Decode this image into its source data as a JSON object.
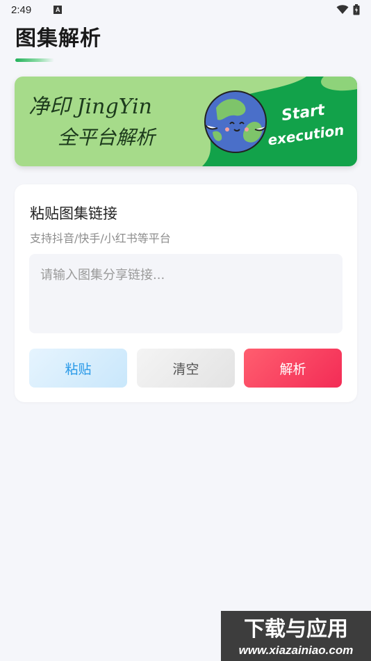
{
  "status_bar": {
    "time": "2:49",
    "notification_icon": "A",
    "icons": [
      "wifi-icon",
      "battery-icon"
    ]
  },
  "header": {
    "title": "图集解析",
    "accent_color": "#22b15a"
  },
  "banner": {
    "title": "净印 JingYin",
    "subtitle": "全平台解析",
    "cta_line1": "Start",
    "cta_line2": "execution",
    "icon": "globe-mascot-icon",
    "bg_light": "#a6db8a",
    "bg_dark": "#12a24a"
  },
  "card": {
    "title": "粘贴图集链接",
    "subtitle": "支持抖音/快手/小红书等平台",
    "input": {
      "value": "",
      "placeholder": "请输入图集分享链接..."
    },
    "buttons": {
      "paste_label": "粘贴",
      "clear_label": "清空",
      "parse_label": "解析"
    }
  },
  "watermark": {
    "title": "下载与应用",
    "url": "www.xiazainiao.com"
  }
}
